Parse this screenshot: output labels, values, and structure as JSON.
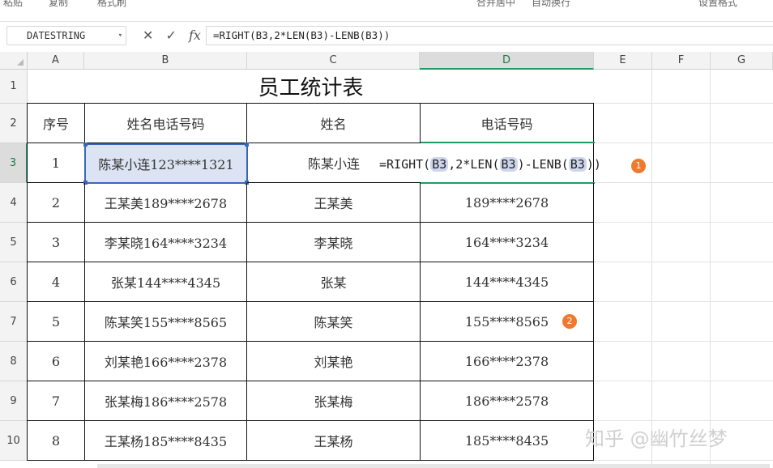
{
  "toolbar": {
    "items": [
      "粘贴",
      "复制",
      "格式刷",
      "合并居中",
      "自动换行",
      "设置格式"
    ]
  },
  "namebox": "DATESTRING",
  "formula": "=RIGHT(B3,2*LEN(B3)-LENB(B3))",
  "formula_icons": {
    "cancel": "✕",
    "confirm": "✓",
    "fx": "fx"
  },
  "columns": [
    "A",
    "B",
    "C",
    "D",
    "E",
    "F",
    "G"
  ],
  "rows": [
    "1",
    "2",
    "3",
    "4",
    "5",
    "6",
    "7",
    "8",
    "9",
    "10"
  ],
  "sheet": {
    "title": "员工统计表",
    "headers": [
      "序号",
      "姓名电话号码",
      "姓名",
      "电话号码"
    ],
    "data": [
      [
        "1",
        "陈某小连123****1321",
        "陈某小连",
        ""
      ],
      [
        "2",
        "王某美189****2678",
        "王某美",
        "189****2678"
      ],
      [
        "3",
        "李某晓164****3234",
        "李某晓",
        "164****3234"
      ],
      [
        "4",
        "张某144****4345",
        "张某",
        "144****4345"
      ],
      [
        "5",
        "陈某笑155****8565",
        "陈某笑",
        "155****8565"
      ],
      [
        "6",
        "刘某艳166****2378",
        "刘某艳",
        "166****2378"
      ],
      [
        "7",
        "张某梅186****2578",
        "张某梅",
        "186****2578"
      ],
      [
        "8",
        "王某杨185****8435",
        "王某杨",
        "185****8435"
      ]
    ]
  },
  "edit_formula": {
    "p1": "=RIGHT(",
    "r1": "B3",
    "p2": ",2*LEN(",
    "r2": "B3",
    "p3": ")-LENB(",
    "r3": "B3",
    "p4": "))"
  },
  "badges": [
    "1",
    "2"
  ],
  "watermark": "知乎 @幽竹丝梦",
  "colors": {
    "accent": "#1e9c64",
    "selection": "#3a66b8",
    "badge": "#ee7a2d"
  }
}
